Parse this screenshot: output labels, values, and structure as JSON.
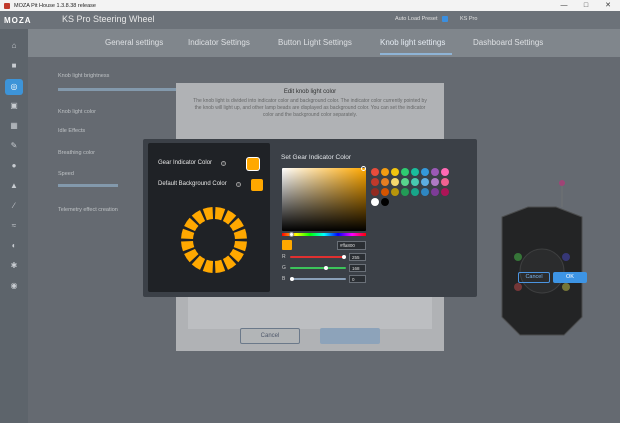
{
  "window": {
    "title": "MOZA Pit House 1.3.8.38 release",
    "controls": [
      "—",
      "□",
      "✕"
    ]
  },
  "header": {
    "brand": "MOZA",
    "device": "KS Pro Steering Wheel",
    "auto_load_preset_label": "Auto Load Preset",
    "preset_value": "KS Pro"
  },
  "tabs": [
    {
      "label": "General settings",
      "active": false
    },
    {
      "label": "Indicator Settings",
      "active": false
    },
    {
      "label": "Button Light Settings",
      "active": false
    },
    {
      "label": "Knob light settings",
      "active": true
    },
    {
      "label": "Dashboard Settings",
      "active": false
    }
  ],
  "sidebar": {
    "icons": [
      "home-icon",
      "camera-icon",
      "wheel-icon",
      "controller-icon",
      "gear-shift-icon",
      "wrench-icon",
      "pedal-icon",
      "handbrake-icon",
      "shifter-icon",
      "chart-icon",
      "dashboard-icon",
      "settings-icon",
      "profile-icon"
    ]
  },
  "main": {
    "rows": [
      "Knob light brightness",
      "Knob light color",
      "Idle Effects",
      "Breathing color",
      "Speed",
      "Telemetry effect creation"
    ]
  },
  "edit_dialog": {
    "title": "Edit knob light color",
    "description": "The knob light is divided into indicator color and background color. The indicator color currently pointed by the knob will light up, and other lamp beads are displayed as background color. You can set the indicator color and the background color separately.",
    "cancel_label": "Cancel"
  },
  "color_dialog": {
    "gear_indicator_label": "Gear Indicator Color",
    "default_background_label": "Default Background Color",
    "gear_indicator_color": "#ffa800",
    "default_background_color": "#ffa800",
    "ring_segments": 16,
    "picker_title": "Set Gear Indicator Color",
    "hex_value": "#ffa800",
    "channels": [
      {
        "name": "R",
        "value": "255",
        "fraction": 1.0,
        "color": "#e03030"
      },
      {
        "name": "G",
        "value": "168",
        "fraction": 0.659,
        "color": "#3cc45a"
      },
      {
        "name": "B",
        "value": "0",
        "fraction": 0.0,
        "color": "#8aa0b8"
      }
    ],
    "palette": [
      "#e74c3c",
      "#f39c12",
      "#f1c40f",
      "#2ecc71",
      "#1abc9c",
      "#3498db",
      "#9b59b6",
      "#ff69b4",
      "#c0392b",
      "#e67e22",
      "#f5d76e",
      "#58d68d",
      "#48c9b0",
      "#5dade2",
      "#af7ac5",
      "#f06292",
      "#922b21",
      "#d35400",
      "#b7950b",
      "#239b56",
      "#17a589",
      "#2e86c1",
      "#7d3c98",
      "#ad1457",
      "#ffffff",
      "#000000"
    ],
    "cancel_label": "Cancel",
    "ok_label": "OK"
  }
}
